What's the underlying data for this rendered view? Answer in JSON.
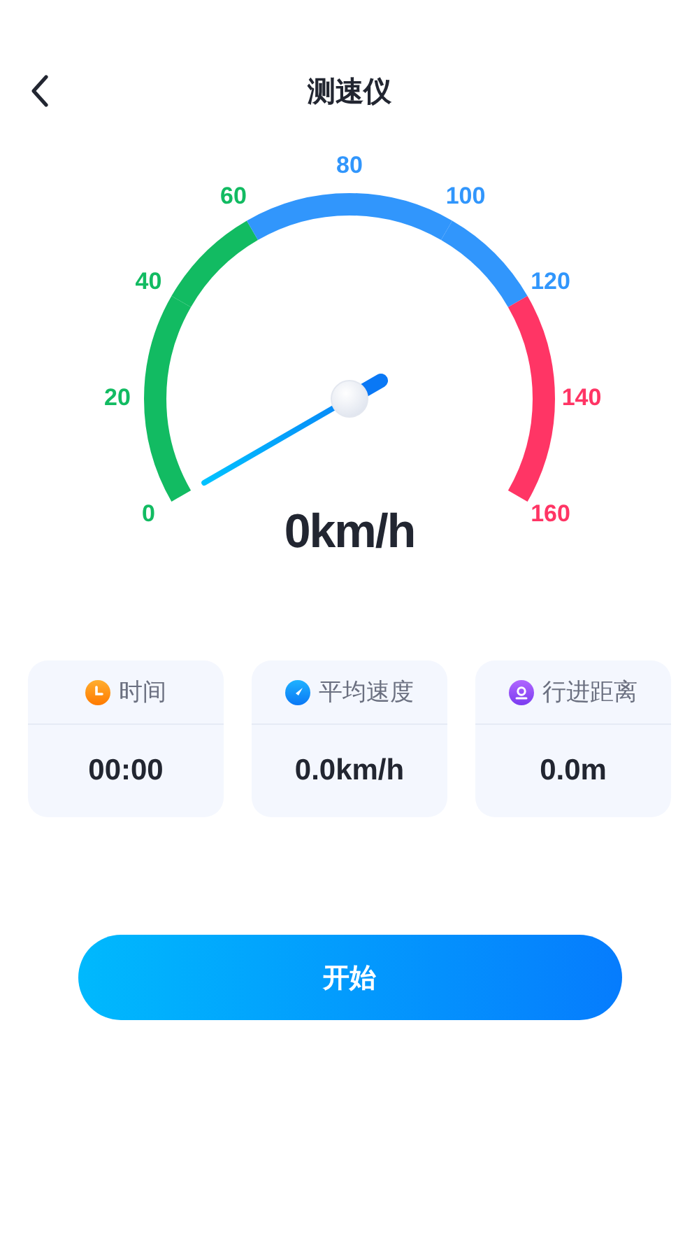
{
  "header": {
    "title": "测速仪"
  },
  "gauge": {
    "ticks": [
      {
        "label": "0",
        "color": "#12bb62"
      },
      {
        "label": "20",
        "color": "#12bb62"
      },
      {
        "label": "40",
        "color": "#12bb62"
      },
      {
        "label": "60",
        "color": "#12bb62"
      },
      {
        "label": "80",
        "color": "#3196fc"
      },
      {
        "label": "100",
        "color": "#3196fc"
      },
      {
        "label": "120",
        "color": "#3196fc"
      },
      {
        "label": "140",
        "color": "#ff3565"
      },
      {
        "label": "160",
        "color": "#ff3565"
      }
    ],
    "reading": "0km/h"
  },
  "stats": [
    {
      "kind": "time",
      "label": "时间",
      "value": "00:00"
    },
    {
      "kind": "speed",
      "label": "平均速度",
      "value": "0.0km/h"
    },
    {
      "kind": "distance",
      "label": "行进距离",
      "value": "0.0m"
    }
  ],
  "start_button": "开始"
}
